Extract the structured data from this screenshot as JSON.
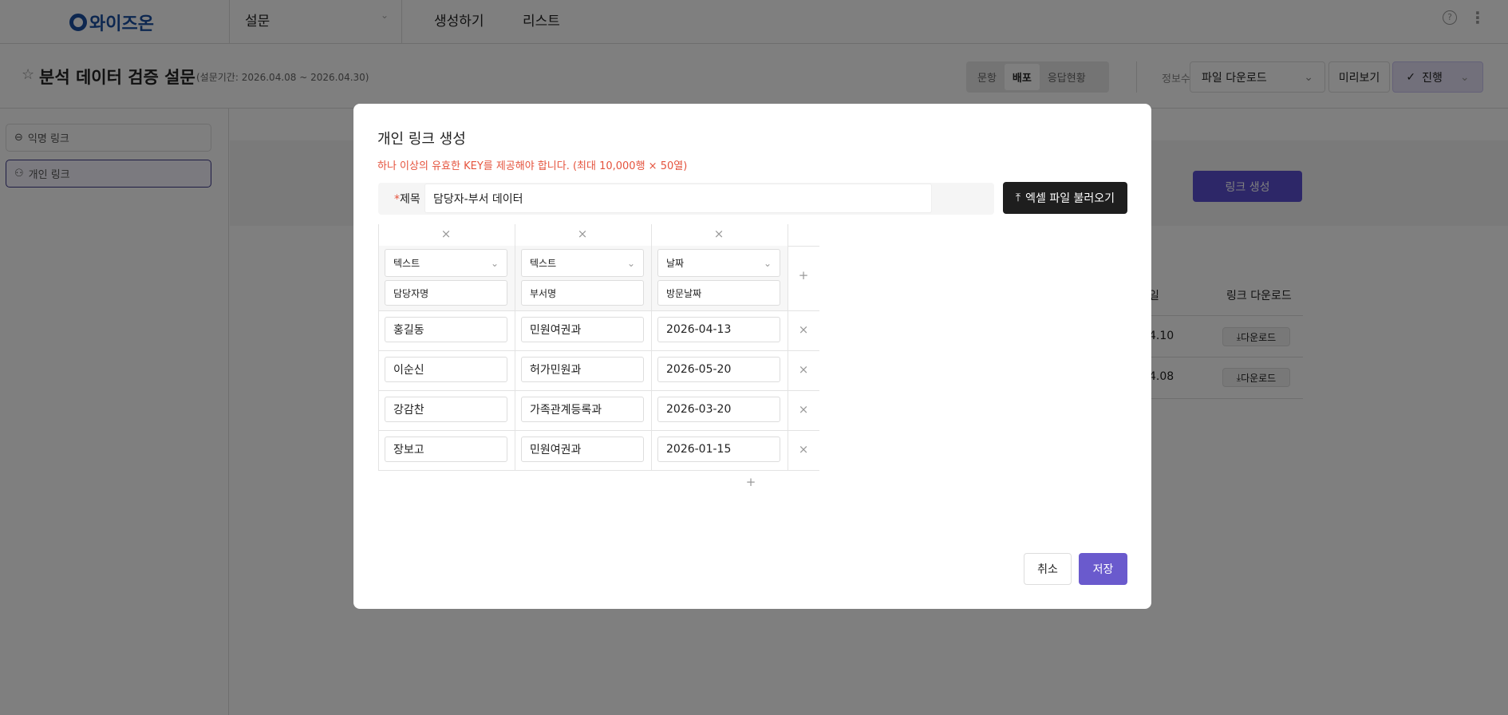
{
  "header": {
    "logo": "와이즈온",
    "menu_select": "설문",
    "nav": [
      "생성하기",
      "리스트"
    ]
  },
  "survey": {
    "title": "분석 데이터 검증 설문",
    "period": "(설문기간: 2026.04.08 ~ 2026.04.30)"
  },
  "toolbar": {
    "segments": [
      "문항",
      "배포",
      "응답현황"
    ],
    "active_segment": "배포",
    "edit_info": "정보수정",
    "file_download": "파일 다운로드",
    "preview": "미리보기",
    "progress": "진행"
  },
  "sidebar": {
    "items": [
      "익명 링크",
      "개인 링크"
    ],
    "active": "개인 링크"
  },
  "main": {
    "create_link": "링크 생성",
    "table_headers": [
      "일",
      "링크 다운로드"
    ],
    "rows": [
      {
        "date": "4.10",
        "action": "다운로드"
      },
      {
        "date": "4.08",
        "action": "다운로드"
      }
    ]
  },
  "modal": {
    "title": "개인 링크 생성",
    "warning": "하나 이상의 유효한 KEY를 제공해야 합니다. (최대 10,000행 × 50열)",
    "name_label": "제목",
    "name_value": "담당자-부서 데이터",
    "excel_button": "엑셀 파일 불러오기",
    "columns": [
      {
        "type": "텍스트",
        "name": "담당자명"
      },
      {
        "type": "텍스트",
        "name": "부서명"
      },
      {
        "type": "날짜",
        "name": "방문날짜"
      }
    ],
    "rows": [
      [
        "홍길동",
        "민원여권과",
        "2026-04-13"
      ],
      [
        "이순신",
        "허가민원과",
        "2026-05-20"
      ],
      [
        "강감찬",
        "가족관계등록과",
        "2026-03-20"
      ],
      [
        "장보고",
        "민원여권과",
        "2026-01-15"
      ]
    ],
    "cancel": "취소",
    "save": "저장"
  },
  "colors": {
    "accent": "#6a5acd",
    "warning": "#e5533d",
    "dark_button": "#1e1e1e"
  }
}
